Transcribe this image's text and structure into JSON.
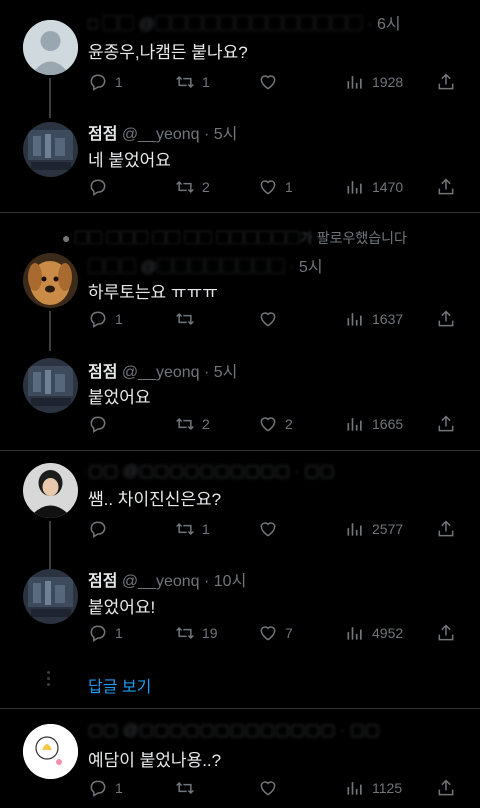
{
  "colors": {
    "bg": "#000000",
    "text": "#e7e9ea",
    "muted": "#71767b",
    "accent": "#1d9bf0",
    "divider": "#2f3336"
  },
  "icons": {
    "reply": "reply-icon",
    "retweet": "retweet-icon",
    "like": "heart-icon",
    "views": "views-icon",
    "share": "share-icon"
  },
  "tweets": [
    {
      "name": "",
      "handle": "",
      "time": "6시",
      "text": "윤종우,나캠든 붙나요?",
      "replies": "1",
      "retweets": "1",
      "likes": "",
      "views": "1928"
    },
    {
      "name": "점점",
      "handle": "@__yeonq",
      "time": "5시",
      "text": "네 붙었어요",
      "replies": "",
      "retweets": "2",
      "likes": "1",
      "views": "1470"
    },
    {
      "name": "",
      "handle": "",
      "time": "5시",
      "text": "하루토는요 ㅠㅠㅠ",
      "replies": "1",
      "retweets": "",
      "likes": "",
      "views": "1637"
    },
    {
      "name": "점점",
      "handle": "@__yeonq",
      "time": "5시",
      "text": "붙었어요",
      "replies": "",
      "retweets": "2",
      "likes": "2",
      "views": "1665"
    },
    {
      "name": "",
      "handle": "",
      "time": "",
      "text": "쌤.. 차이진신은요?",
      "replies": "",
      "retweets": "1",
      "likes": "",
      "views": "2577"
    },
    {
      "name": "점점",
      "handle": "@__yeonq",
      "time": "10시",
      "text": "붙었어요!",
      "replies": "1",
      "retweets": "19",
      "likes": "7",
      "views": "4952"
    },
    {
      "name": "",
      "handle": "",
      "time": "",
      "text": "예담이 붙었나용..?",
      "replies": "1",
      "retweets": "",
      "likes": "",
      "views": "1125"
    }
  ],
  "retweeted_note": "팔로우했습니다",
  "show_replies": "답글 보기"
}
